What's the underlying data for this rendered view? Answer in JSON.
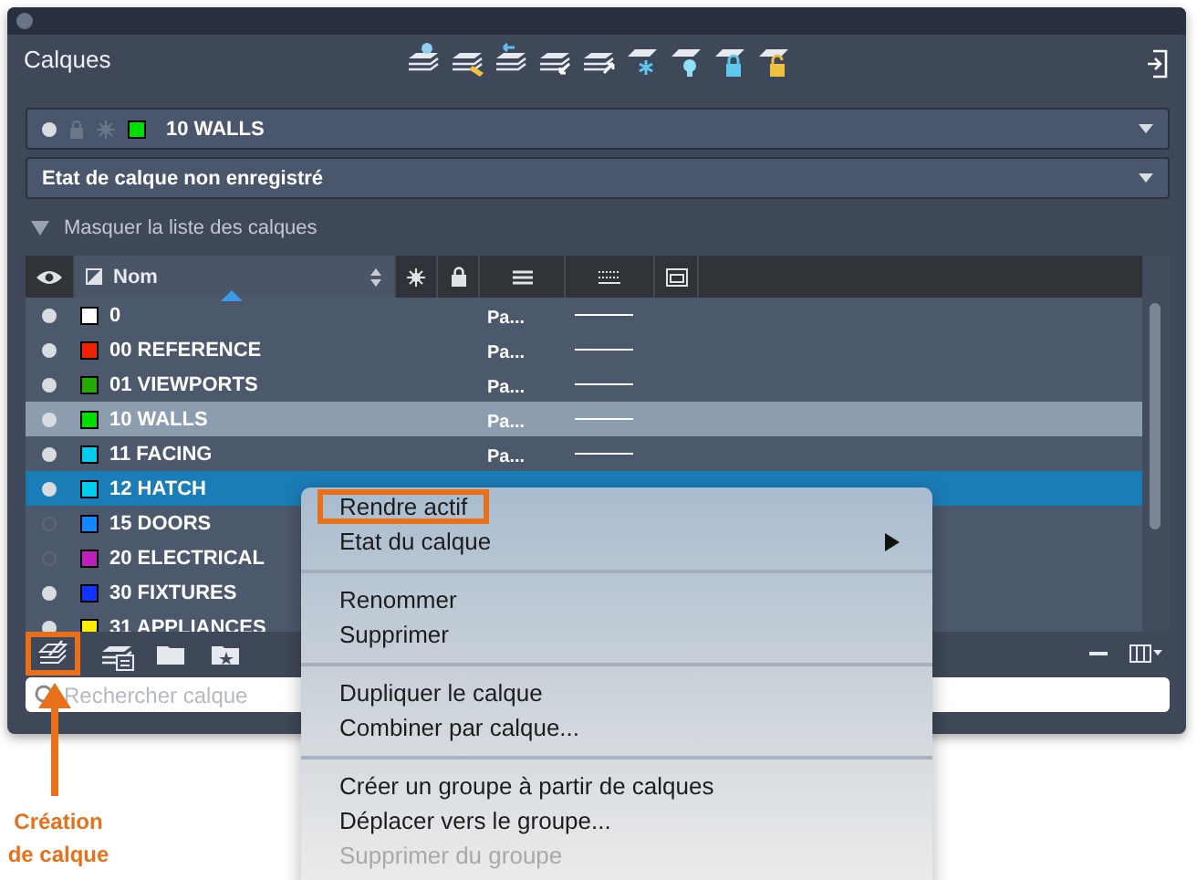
{
  "panel": {
    "title": "Calques"
  },
  "current_layer": {
    "name": "10 WALLS",
    "color": "#00dd00"
  },
  "layer_state": {
    "value": "Etat de calque non enregistré"
  },
  "list_toggle": {
    "label": "Masquer la liste des calques",
    "expanded": true
  },
  "table": {
    "columns": [
      {
        "kind": "visibility"
      },
      {
        "kind": "name",
        "label": "Nom",
        "sorted": true
      },
      {
        "kind": "freeze"
      },
      {
        "kind": "lock"
      },
      {
        "kind": "plot"
      },
      {
        "kind": "linetype"
      },
      {
        "kind": "viewport"
      }
    ],
    "rows": [
      {
        "name": "0",
        "color": "#ffffff",
        "visible": true,
        "plot": "Pa...",
        "current": false,
        "selected": false
      },
      {
        "name": "00 REFERENCE",
        "color": "#ee2200",
        "visible": true,
        "plot": "Pa...",
        "current": false,
        "selected": false
      },
      {
        "name": "01 VIEWPORTS",
        "color": "#22aa00",
        "visible": true,
        "plot": "Pa...",
        "current": false,
        "selected": false
      },
      {
        "name": "10 WALLS",
        "color": "#00dd00",
        "visible": true,
        "plot": "Pa...",
        "current": true,
        "selected": false
      },
      {
        "name": "11 FACING",
        "color": "#00ccee",
        "visible": true,
        "plot": "Pa...",
        "current": false,
        "selected": false
      },
      {
        "name": "12 HATCH",
        "color": "#00ccee",
        "visible": true,
        "current": false,
        "selected": true
      },
      {
        "name": "15 DOORS",
        "color": "#1188ff",
        "visible": false,
        "current": false,
        "selected": false
      },
      {
        "name": "20 ELECTRICAL",
        "color": "#bb22bb",
        "visible": false,
        "current": false,
        "selected": false
      },
      {
        "name": "30 FIXTURES",
        "color": "#1133ff",
        "visible": true,
        "current": false,
        "selected": false
      },
      {
        "name": "31 APPLIANCES",
        "color": "#ffee00",
        "visible": true,
        "current": false,
        "selected": false
      }
    ]
  },
  "bottom_toolbar": {
    "left": [
      {
        "kind": "new-layer",
        "highlighted": true
      },
      {
        "kind": "new-layer-list",
        "highlighted": false
      },
      {
        "kind": "folder",
        "highlighted": false
      },
      {
        "kind": "folder-star",
        "highlighted": false
      }
    ]
  },
  "search": {
    "placeholder": "Rechercher calque"
  },
  "context_menu": {
    "groups": [
      [
        {
          "label": "Rendre actif",
          "highlighted": true,
          "submenu": false,
          "disabled": false
        },
        {
          "label": "Etat du calque",
          "highlighted": false,
          "submenu": true,
          "disabled": false
        }
      ],
      [
        {
          "label": "Renommer",
          "highlighted": false,
          "submenu": false,
          "disabled": false
        },
        {
          "label": "Supprimer",
          "highlighted": false,
          "submenu": false,
          "disabled": false
        }
      ],
      [
        {
          "label": "Dupliquer le calque",
          "highlighted": false,
          "submenu": false,
          "disabled": false
        },
        {
          "label": "Combiner par calque...",
          "highlighted": false,
          "submenu": false,
          "disabled": false
        }
      ],
      [
        {
          "label": "Créer un groupe à partir de calques",
          "highlighted": false,
          "submenu": false,
          "disabled": false
        },
        {
          "label": "Déplacer vers le groupe...",
          "highlighted": false,
          "submenu": false,
          "disabled": false
        },
        {
          "label": "Supprimer du groupe",
          "highlighted": false,
          "submenu": false,
          "disabled": true
        }
      ]
    ]
  },
  "callout": {
    "label": "Création de calque"
  }
}
